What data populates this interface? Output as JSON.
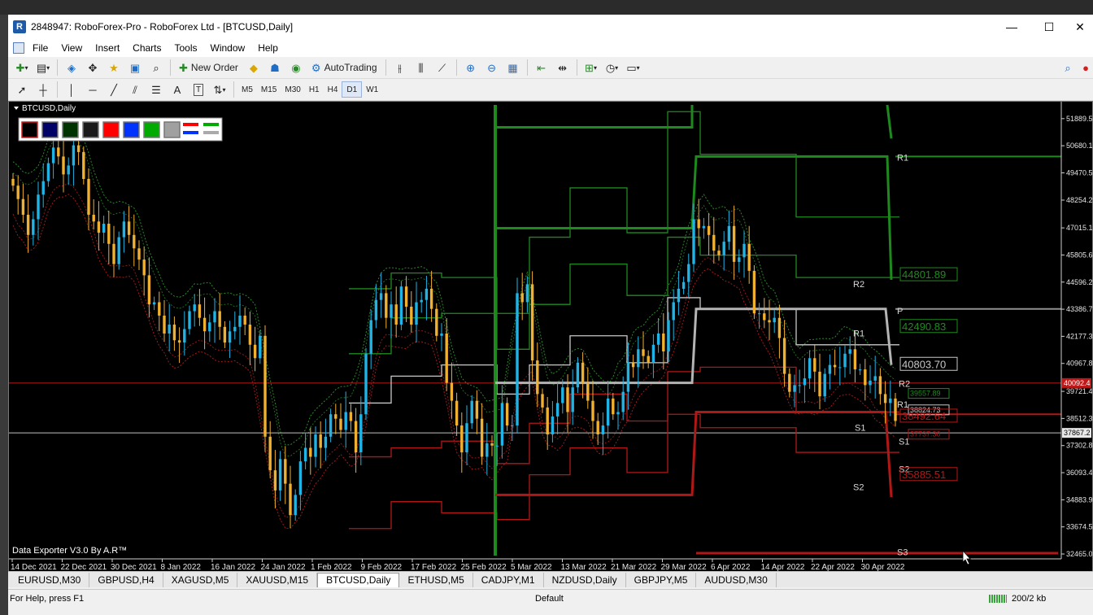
{
  "window": {
    "title": "2848947: RoboForex-Pro - RoboForex Ltd - [BTCUSD,Daily]",
    "minimize": "—",
    "maximize": "☐",
    "close": "✕",
    "doc_minimize": "–",
    "doc_restore": "❐"
  },
  "menu": {
    "items": [
      "File",
      "View",
      "Insert",
      "Charts",
      "Tools",
      "Window",
      "Help"
    ]
  },
  "toolbar": {
    "new_order": "New Order",
    "autotrading": "AutoTrading",
    "icons": {
      "new_chart": "new-chart-icon",
      "profiles": "profiles-icon",
      "market_watch": "market-watch-icon",
      "data_window": "data-window-icon",
      "navigator": "navigator-icon",
      "terminal": "terminal-icon",
      "tester": "strategy-tester-icon",
      "meta_editor": "meta-editor-icon",
      "signals": "signals-icon",
      "bar_chart": "bar-chart-icon",
      "candlesticks": "candlesticks-icon",
      "line_chart": "line-chart-icon",
      "zoom_in": "zoom-in-icon",
      "zoom_out": "zoom-out-icon",
      "tile": "tile-windows-icon",
      "auto_scroll": "auto-scroll-icon",
      "chart_shift": "chart-shift-icon",
      "indicators": "indicators-icon",
      "periods": "periods-icon",
      "templates": "templates-icon",
      "search": "search-icon"
    }
  },
  "tools": {
    "timeframes": [
      "M5",
      "M15",
      "M30",
      "H1",
      "H4",
      "D1",
      "W1"
    ],
    "active_timeframe": "D1",
    "text_tool": "A",
    "label_tool": "T"
  },
  "chart": {
    "symbol_label": "BTCUSD,Daily",
    "watermark": "Data Exporter V3.0 By A.R™",
    "colors": {
      "background": "#000000",
      "bull": "#1fb3e6",
      "bear": "#f0b030",
      "green": "#1e8a1e",
      "red": "#b01818",
      "gray": "#b4b4b4",
      "current_line": "#c01818"
    },
    "palette": [
      "#000000",
      "#000066",
      "#003300",
      "#1a1a1a",
      "#ff0000",
      "#0033ff",
      "#00aa00",
      "#a0a0a0"
    ],
    "levels_right": [
      {
        "text": "R1"
      },
      {
        "text": "R2"
      },
      {
        "text": "P"
      },
      {
        "text": "R1"
      },
      {
        "text": "R2"
      },
      {
        "text": "R1"
      },
      {
        "text": "S1"
      },
      {
        "text": "S2"
      },
      {
        "text": "S1"
      },
      {
        "text": "S2"
      },
      {
        "text": "S3"
      }
    ],
    "price_boxes": [
      {
        "text": "44801.89",
        "color": "#1e8a1e"
      },
      {
        "text": "42490.83",
        "color": "#1e8a1e"
      },
      {
        "text": "40803.70",
        "color": "#c8c8c8"
      },
      {
        "text": "39557.89",
        "color": "#1e8a1e"
      },
      {
        "text": "38824.73",
        "color": "#c8c8c8"
      },
      {
        "text": "38492.64",
        "color": "#b01818"
      },
      {
        "text": "37737.30",
        "color": "#b01818"
      },
      {
        "text": "35885.51",
        "color": "#b01818"
      }
    ],
    "current_price_tag": "40092.4",
    "bid_tag": "37867.2"
  },
  "chart_data": {
    "type": "candlestick",
    "title": "BTCUSD,Daily",
    "y_ticks": [
      51889.5,
      50680.1,
      49470.5,
      48254.2,
      47015.1,
      45805.6,
      44596.2,
      43386.7,
      42177.3,
      40967.8,
      39721.4,
      38512.3,
      37302.8,
      36093.4,
      34883.9,
      33674.5,
      32465.0
    ],
    "ylim": [
      32465.0,
      52500.0
    ],
    "x_ticks": [
      "14 Dec 2021",
      "22 Dec 2021",
      "30 Dec 2021",
      "8 Jan 2022",
      "16 Jan 2022",
      "24 Jan 2022",
      "1 Feb 2022",
      "9 Feb 2022",
      "17 Feb 2022",
      "25 Feb 2022",
      "5 Mar 2022",
      "13 Mar 2022",
      "21 Mar 2022",
      "29 Mar 2022",
      "6 Apr 2022",
      "14 Apr 2022",
      "22 Apr 2022",
      "30 Apr 2022"
    ],
    "close": [
      48900,
      48300,
      47600,
      46700,
      47400,
      48500,
      49100,
      49900,
      50600,
      50200,
      49400,
      49800,
      50700,
      50400,
      49200,
      47600,
      47300,
      46800,
      47200,
      46300,
      45400,
      46600,
      47300,
      46700,
      46100,
      45600,
      44900,
      43600,
      43700,
      43100,
      42300,
      42700,
      42000,
      41900,
      42500,
      43300,
      43600,
      43000,
      42400,
      42800,
      43300,
      42600,
      41900,
      42400,
      42600,
      43100,
      42700,
      41800,
      41200,
      42200,
      37700,
      36200,
      35300,
      36700,
      35600,
      34200,
      35100,
      36600,
      37200,
      36800,
      37800,
      37200,
      37700,
      38700,
      38500,
      38000,
      38800,
      38400,
      37000,
      38700,
      41400,
      42900,
      43800,
      44100,
      43000,
      43600,
      42700,
      44400,
      43500,
      42700,
      43700,
      43800,
      44300,
      43400,
      42200,
      42300,
      40100,
      39300,
      38200,
      37000,
      38300,
      39300,
      38500,
      36800,
      37400,
      37300,
      37300,
      39200,
      38200,
      38200,
      44100,
      43700,
      44500,
      41100,
      39600,
      39000,
      37800,
      38600,
      39200,
      39900,
      38800,
      39900,
      41000,
      40100,
      39300,
      38400,
      37800,
      38200,
      39400,
      38700,
      38800,
      39700,
      41000,
      40800,
      41600,
      41300,
      41000,
      41800,
      42300,
      41500,
      42900,
      43700,
      44300,
      44600,
      45400,
      47400,
      47000,
      47100,
      46700,
      46000,
      45800,
      46400,
      47100,
      45500,
      45700,
      46300,
      45100,
      43200,
      43200,
      42900,
      42800,
      43000,
      42100,
      40500,
      39700,
      40000,
      40000,
      40300,
      41200,
      40600,
      39500,
      40500,
      40900,
      40800,
      40800,
      41400,
      41600,
      40700,
      40700,
      40000,
      40200,
      40400,
      39600,
      39200,
      39400,
      38400
    ]
  },
  "tabs": [
    {
      "label": "EURUSD,M30",
      "active": false
    },
    {
      "label": "GBPUSD,H4",
      "active": false
    },
    {
      "label": "XAGUSD,M5",
      "active": false
    },
    {
      "label": "XAUUSD,M15",
      "active": false
    },
    {
      "label": "BTCUSD,Daily",
      "active": true
    },
    {
      "label": "ETHUSD,M5",
      "active": false
    },
    {
      "label": "CADJPY,M1",
      "active": false
    },
    {
      "label": "NZDUSD,Daily",
      "active": false
    },
    {
      "label": "GBPJPY,M5",
      "active": false
    },
    {
      "label": "AUDUSD,M30",
      "active": false
    }
  ],
  "status": {
    "help": "For Help, press F1",
    "profile": "Default",
    "traffic": "200/2 kb"
  }
}
